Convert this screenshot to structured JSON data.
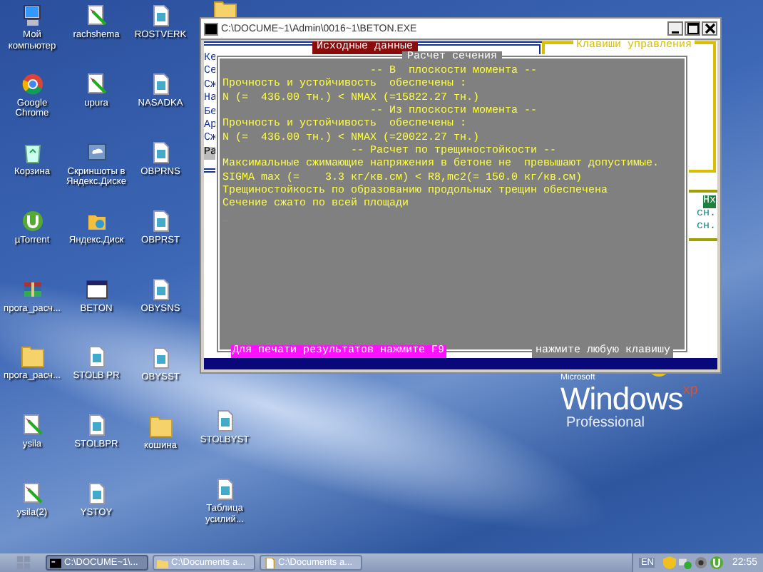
{
  "desktop": {
    "columns": [
      [
        {
          "label": "Мой компьютер",
          "kind": "computer"
        },
        {
          "label": "Google Chrome",
          "kind": "chrome"
        },
        {
          "label": "Корзина",
          "kind": "recycle"
        },
        {
          "label": "µTorrent",
          "kind": "torrent"
        },
        {
          "label": "прога_расч...",
          "kind": "archive"
        },
        {
          "label": "прога_расч...",
          "kind": "folder"
        },
        {
          "label": "ysila",
          "kind": "pen"
        },
        {
          "label": "ysila(2)",
          "kind": "pen"
        }
      ],
      [
        {
          "label": "rachshema",
          "kind": "pen"
        },
        {
          "label": "upura",
          "kind": "pen"
        },
        {
          "label": "Скриншоты в Яндекс.Диске",
          "kind": "cloud"
        },
        {
          "label": "Яндекс.Диск",
          "kind": "disk"
        },
        {
          "label": "BETON",
          "kind": "window"
        },
        {
          "label": "STOLB PR",
          "kind": "doc"
        },
        {
          "label": "STOLBPR",
          "kind": "doc"
        },
        {
          "label": "YSTOY",
          "kind": "doc"
        }
      ],
      [
        {
          "label": "ROSTVERK",
          "kind": "doc"
        },
        {
          "label": "NASADKA",
          "kind": "doc"
        },
        {
          "label": "OBPRNS",
          "kind": "doc"
        },
        {
          "label": "OBPRST",
          "kind": "doc"
        },
        {
          "label": "OBYSNS",
          "kind": "doc"
        },
        {
          "label": "OBYSST",
          "kind": "doc"
        },
        {
          "label": "кошина",
          "kind": "folder"
        }
      ],
      [
        {
          "kind": "folder"
        },
        {
          "label": "STOLBYST",
          "kind": "doc"
        },
        {
          "label": "Таблица усилий...",
          "kind": "doc"
        }
      ]
    ]
  },
  "console": {
    "title": "C:\\DOCUME~1\\Admin\\0016~1\\BETON.EXE",
    "input_panel": {
      "title": "Исходные данные",
      "rows": [
        {
          "label": "Ке",
          "selected": false
        },
        {
          "label": "Се",
          "selected": false
        },
        {
          "label": "Сж",
          "selected": false
        },
        {
          "label": "На",
          "selected": false
        },
        {
          "label": "Бе",
          "selected": false
        },
        {
          "label": "Ар",
          "selected": false
        },
        {
          "label": "Сж",
          "selected": false
        },
        {
          "label": "Ра",
          "selected": true
        }
      ]
    },
    "keys_panel": {
      "title": "Клавиши управления",
      "items": [
        {
          "label": "Нх",
          "selected": true
        },
        {
          "label": "сн.",
          "selected": false
        },
        {
          "label": "сн.",
          "selected": false
        }
      ]
    },
    "dialog": {
      "title": "Расчет сечения",
      "lines": [
        {
          "text": "-- В  плоскости момента --",
          "kind": "heading"
        },
        {
          "text": "Прочность и устойчивость  обеспечены :",
          "kind": "text"
        },
        {
          "text": "N (=  436.00 тн.) < NMAX (=15822.27 тн.)",
          "kind": "text"
        },
        {
          "text": "-- Из плоскости момента --",
          "kind": "heading"
        },
        {
          "text": "Прочность и устойчивость  обеспечены :",
          "kind": "text"
        },
        {
          "text": "N (=  436.00 тн.) < NMAX (=20022.27 тн.)",
          "kind": "text"
        },
        {
          "text": "-- Расчет по трещиностойкости --",
          "kind": "heading"
        },
        {
          "text": "Максимальные сжимающие напряжения в бетоне не  превышают допустимые.",
          "kind": "text"
        },
        {
          "text": "SIGMA max (=    3.3 кг/кв.см) < R8,mc2(= 150.0 кг/кв.см)",
          "kind": "text"
        },
        {
          "text": "Трещиностойкость по образованию продольных трещин обеспечена",
          "kind": "text"
        },
        {
          "text": "Сечение сжато по всей площади",
          "kind": "text"
        }
      ],
      "cursor": "_",
      "print_hint": "Для печати результатов нажмите F9",
      "key_hint": "нажмите любую клавишу"
    }
  },
  "logo": {
    "brand": "Microsoft",
    "product": "Windows",
    "version": "xp",
    "edition": "Professional"
  },
  "taskbar": {
    "tasks": [
      {
        "label": "C:\\DOCUME~1\\...",
        "kind": "console",
        "selected": true
      },
      {
        "label": "C:\\Documents a...",
        "kind": "folder",
        "selected": false
      },
      {
        "label": "C:\\Documents a...",
        "kind": "doc",
        "selected": false
      }
    ],
    "language": "EN",
    "time": "22:55"
  }
}
